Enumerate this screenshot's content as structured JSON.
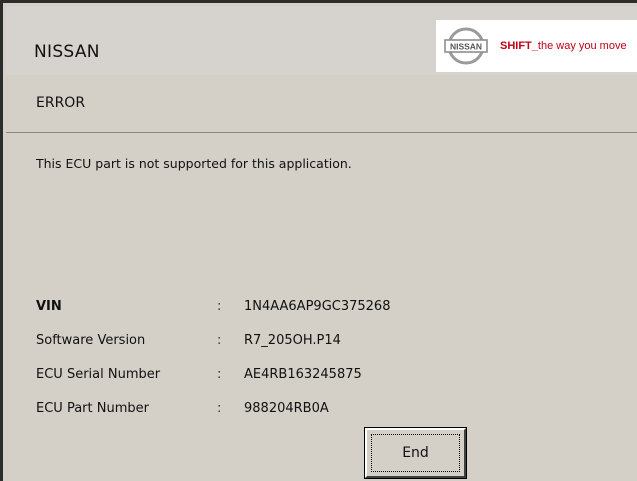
{
  "window": {
    "app_title": "NISSAN"
  },
  "branding": {
    "logo_text": "NISSAN",
    "tagline_bold": "SHIFT_",
    "tagline_rest": "the way you move",
    "brand_color": "#c00014"
  },
  "dialog": {
    "heading": "ERROR",
    "message": "This ECU part is not supported for this application.",
    "fields": [
      {
        "label": "VIN",
        "value": "1N4AA6AP9GC375268"
      },
      {
        "label": "Software Version",
        "value": "R7_205OH.P14"
      },
      {
        "label": "ECU Serial Number",
        "value": "AE4RB163245875"
      },
      {
        "label": "ECU Part Number",
        "value": "988204RB0A"
      }
    ],
    "separator": ":",
    "end_button_label": "End"
  }
}
